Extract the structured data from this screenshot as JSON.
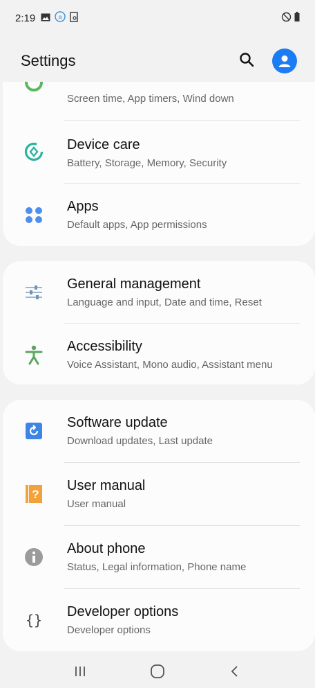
{
  "status_bar": {
    "time": "2:19",
    "left_icons": [
      "image-icon",
      "account-icon",
      "screenshot-icon"
    ],
    "right_icons": [
      "do-not-disturb-icon",
      "battery-icon"
    ]
  },
  "app_bar": {
    "title": "Settings",
    "actions": [
      "search-icon",
      "profile-icon"
    ],
    "accent_color": "#1c7cf4"
  },
  "groups": [
    {
      "items": [
        {
          "title": "",
          "subtitle": "Screen time, App timers, Wind down",
          "icon": "digital-wellbeing-icon",
          "color": "#59b85e"
        },
        {
          "title": "Device care",
          "subtitle": "Battery, Storage, Memory, Security",
          "icon": "device-care-icon",
          "color": "#2db3a0"
        },
        {
          "title": "Apps",
          "subtitle": "Default apps, App permissions",
          "icon": "apps-icon",
          "color": "#4d8ef0"
        }
      ]
    },
    {
      "items": [
        {
          "title": "General management",
          "subtitle": "Language and input, Date and time, Reset",
          "icon": "sliders-icon",
          "color": "#6f96b8"
        },
        {
          "title": "Accessibility",
          "subtitle": "Voice Assistant, Mono audio, Assistant menu",
          "icon": "accessibility-icon",
          "color": "#5aa65e"
        }
      ]
    },
    {
      "items": [
        {
          "title": "Software update",
          "subtitle": "Download updates, Last update",
          "icon": "software-update-icon",
          "color": "#3d86e6"
        },
        {
          "title": "User manual",
          "subtitle": "User manual",
          "icon": "user-manual-icon",
          "color": "#f1a23a"
        },
        {
          "title": "About phone",
          "subtitle": "Status, Legal information, Phone name",
          "icon": "info-icon",
          "color": "#9b9b9b"
        },
        {
          "title": "Developer options",
          "subtitle": "Developer options",
          "icon": "code-braces-icon",
          "color": "#444444"
        }
      ]
    }
  ],
  "nav_bar": {
    "buttons": [
      "recents-icon",
      "home-icon",
      "back-icon"
    ]
  }
}
